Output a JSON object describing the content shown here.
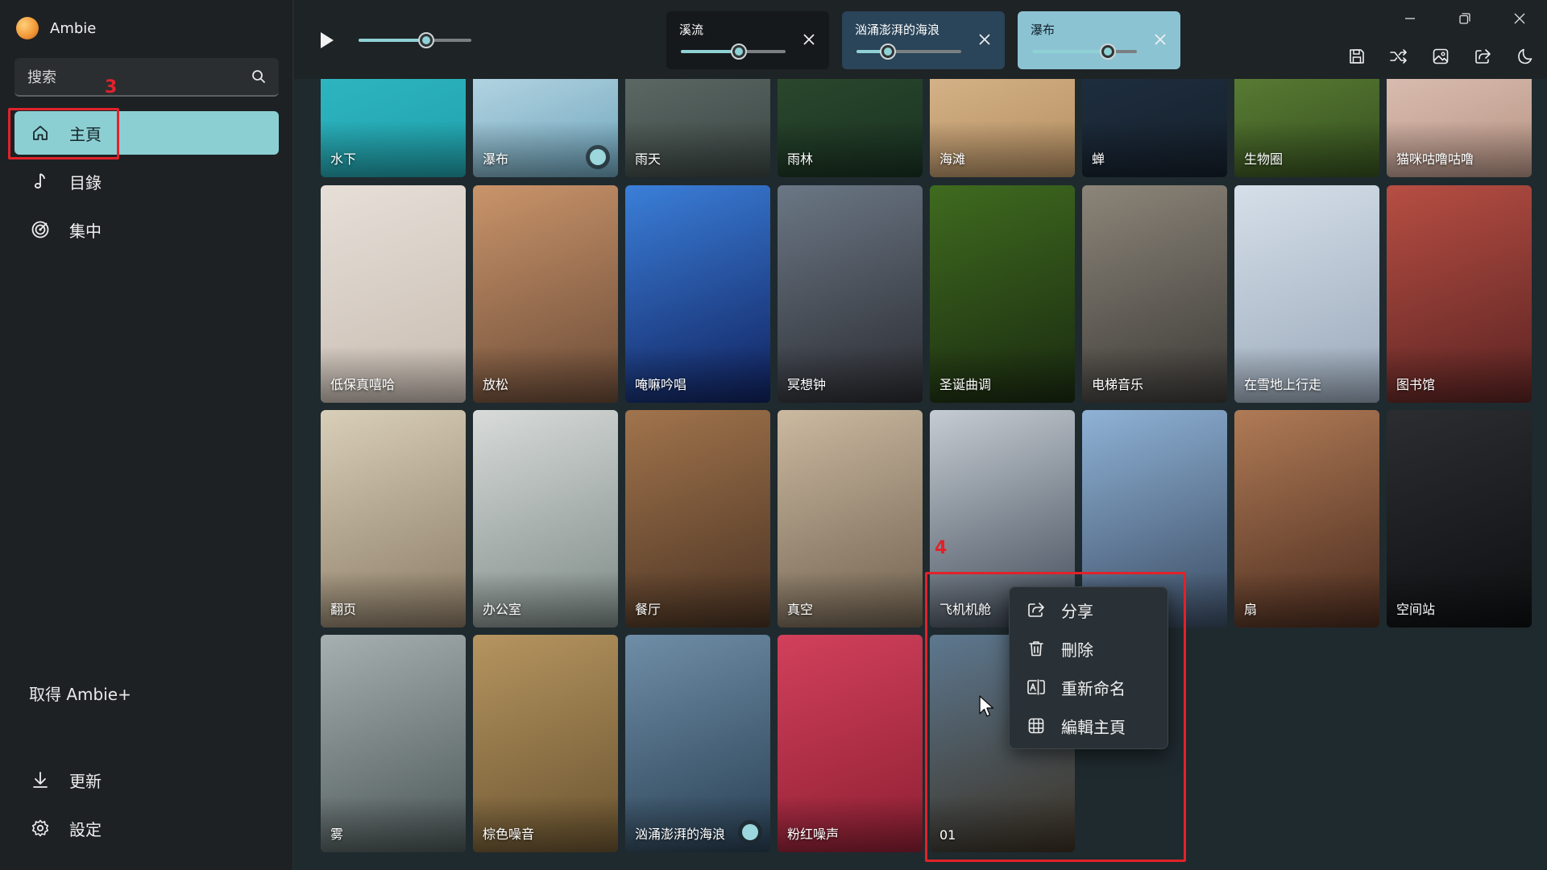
{
  "app": {
    "name": "Ambie"
  },
  "search": {
    "placeholder": "搜索"
  },
  "nav": [
    {
      "label": "主頁",
      "icon": "home-icon",
      "active": true
    },
    {
      "label": "目錄",
      "icon": "music-note-icon",
      "active": false
    },
    {
      "label": "集中",
      "icon": "target-icon",
      "active": false
    }
  ],
  "promo": {
    "label": "取得 Ambie+"
  },
  "bottom_nav": [
    {
      "label": "更新",
      "icon": "download-icon"
    },
    {
      "label": "設定",
      "icon": "gear-icon"
    }
  ],
  "annotations": {
    "nav": "3",
    "tile": "4"
  },
  "player": {
    "master_volume_pct": 60
  },
  "active_mix": [
    {
      "name": "溪流",
      "volume_pct": 55,
      "bg": "#16191b"
    },
    {
      "name": "汹涌澎湃的海浪",
      "volume_pct": 30,
      "bg": "#2a4459"
    },
    {
      "name": "瀑布",
      "volume_pct": 72,
      "bg": "#8cc3d3"
    }
  ],
  "toolbar": [
    "save-icon",
    "shuffle-icon",
    "image-icon",
    "share-icon",
    "moon-icon"
  ],
  "sounds": [
    {
      "name": "水下",
      "art": [
        "#2fb6c1",
        "#1fa3ad"
      ],
      "toggle": false
    },
    {
      "name": "瀑布",
      "art": [
        "#b9d8e4",
        "#6ea5bd"
      ],
      "toggle": true
    },
    {
      "name": "雨天",
      "art": [
        "#5e6b67",
        "#3c4744"
      ],
      "toggle": false
    },
    {
      "name": "雨林",
      "art": [
        "#2c4a2e",
        "#193222"
      ],
      "toggle": false
    },
    {
      "name": "海滩",
      "art": [
        "#d7b58a",
        "#b48e61"
      ],
      "toggle": false
    },
    {
      "name": "蝉",
      "art": [
        "#1f2f40",
        "#15202c"
      ],
      "toggle": false
    },
    {
      "name": "生物圈",
      "art": [
        "#5b7f35",
        "#36511f"
      ],
      "toggle": false
    },
    {
      "name": "猫咪咕噜咕噜",
      "art": [
        "#dcc0b3",
        "#b89485"
      ],
      "toggle": false
    },
    {
      "name": "低保真嘻哈",
      "art": [
        "#e6dfd8",
        "#c8bcb1"
      ],
      "toggle": false
    },
    {
      "name": "放松",
      "art": [
        "#c9946a",
        "#6b4b37"
      ],
      "toggle": false
    },
    {
      "name": "唵嘛吟唱",
      "art": [
        "#3b7fd9",
        "#10215e"
      ],
      "toggle": false
    },
    {
      "name": "冥想钟",
      "art": [
        "#6b7785",
        "#2a2b30"
      ],
      "toggle": false
    },
    {
      "name": "圣诞曲调",
      "art": [
        "#3f6b1f",
        "#1a2a10"
      ],
      "toggle": false
    },
    {
      "name": "电梯音乐",
      "art": [
        "#8c8579",
        "#3c3a37"
      ],
      "toggle": false
    },
    {
      "name": "在雪地上行走",
      "art": [
        "#d5dfe9",
        "#9aa9ba"
      ],
      "toggle": false
    },
    {
      "name": "图书馆",
      "art": [
        "#b74e43",
        "#5a2322"
      ],
      "toggle": false
    },
    {
      "name": "翻页",
      "art": [
        "#d9cfb8",
        "#8a7a64"
      ],
      "toggle": false
    },
    {
      "name": "办公室",
      "art": [
        "#d8dbd9",
        "#7d8a86"
      ],
      "toggle": false
    },
    {
      "name": "餐厅",
      "art": [
        "#a1744c",
        "#4a3323"
      ],
      "toggle": false
    },
    {
      "name": "真空",
      "art": [
        "#cbb9a0",
        "#70614f"
      ],
      "toggle": false
    },
    {
      "name": "飞机机舱",
      "art": [
        "#c5ccd3",
        "#404a57"
      ],
      "toggle": false
    },
    {
      "name": "",
      "art": [
        "#8fb2d6",
        "#3a4b62"
      ],
      "toggle": false
    },
    {
      "name": "扇",
      "art": [
        "#b07b56",
        "#4a2b1e"
      ],
      "toggle": false
    },
    {
      "name": "空间站",
      "art": [
        "#2b2d30",
        "#0e0f11"
      ],
      "toggle": false
    },
    {
      "name": "雾",
      "art": [
        "#a7b0b1",
        "#4a5655"
      ],
      "toggle": false
    },
    {
      "name": "棕色噪音",
      "art": [
        "#b59560",
        "#6b5430"
      ],
      "toggle": false
    },
    {
      "name": "汹涌澎湃的海浪",
      "art": [
        "#6f8ea7",
        "#283f53"
      ],
      "toggle": true
    },
    {
      "name": "粉红噪声",
      "art": [
        "#d2405b",
        "#8e1f33"
      ],
      "toggle": false
    },
    {
      "name": "01",
      "art": [
        "#5d7890",
        "#3a3022"
      ],
      "toggle": false
    }
  ],
  "context_menu": [
    {
      "label": "分享",
      "icon": "share-icon"
    },
    {
      "label": "刪除",
      "icon": "trash-icon"
    },
    {
      "label": "重新命名",
      "icon": "rename-icon"
    },
    {
      "label": "編輯主頁",
      "icon": "grid-icon"
    }
  ],
  "colors": {
    "accent": "#8ccfd3",
    "annotation": "#e1222a"
  }
}
